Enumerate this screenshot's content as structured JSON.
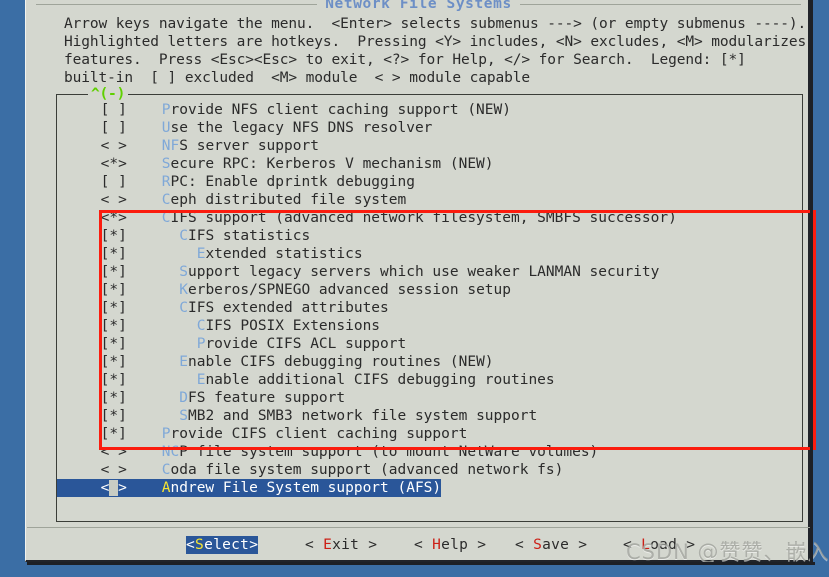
{
  "window": {
    "title": "Network File Systems",
    "background_color": "#3b6ea5",
    "dialog_color": "#d4d7cf"
  },
  "help": {
    "line1": "Arrow keys navigate the menu.  <Enter> selects submenus ---> (or empty submenus ----).",
    "line2": "Highlighted letters are hotkeys.  Pressing <Y> includes, <N> excludes, <M> modularizes",
    "line3": "features.  Press <Esc><Esc> to exit, <?> for Help, </> for Search.  Legend: [*]",
    "line4": "built-in  [ ] excluded  <M> module  < > module capable"
  },
  "scroll_indicator": "^(-)",
  "menu": {
    "items": [
      {
        "tag": "[ ]",
        "indent": 1,
        "hotkey": "P",
        "rest": "rovide NFS client caching support (NEW)",
        "selected": false
      },
      {
        "tag": "[ ]",
        "indent": 1,
        "hotkey": "U",
        "rest": "se the legacy NFS DNS resolver",
        "selected": false
      },
      {
        "tag": "< >",
        "indent": 1,
        "hotkey": "NF",
        "rest": "S server support",
        "selected": false
      },
      {
        "tag": "<*>",
        "indent": 1,
        "hotkey": "S",
        "rest": "ecure RPC: Kerberos V mechanism (NEW)",
        "selected": false
      },
      {
        "tag": "[ ]",
        "indent": 1,
        "hotkey": "R",
        "rest": "PC: Enable dprintk debugging",
        "selected": false
      },
      {
        "tag": "< >",
        "indent": 1,
        "hotkey": "C",
        "rest": "eph distributed file system",
        "selected": false
      },
      {
        "tag": "<*>",
        "indent": 1,
        "hotkey": "C",
        "rest": "IFS support (advanced network filesystem, SMBFS successor)",
        "selected": false
      },
      {
        "tag": "[*]",
        "indent": 2,
        "hotkey": "C",
        "rest": "IFS statistics",
        "selected": false
      },
      {
        "tag": "[*]",
        "indent": 3,
        "hotkey": "E",
        "rest": "xtended statistics",
        "selected": false
      },
      {
        "tag": "[*]",
        "indent": 2,
        "hotkey": "S",
        "rest": "upport legacy servers which use weaker LANMAN security",
        "selected": false
      },
      {
        "tag": "[*]",
        "indent": 2,
        "hotkey": "K",
        "rest": "erberos/SPNEGO advanced session setup",
        "selected": false
      },
      {
        "tag": "[*]",
        "indent": 2,
        "hotkey": "C",
        "rest": "IFS extended attributes",
        "selected": false
      },
      {
        "tag": "[*]",
        "indent": 3,
        "hotkey": "C",
        "rest": "IFS POSIX Extensions",
        "selected": false
      },
      {
        "tag": "[*]",
        "indent": 3,
        "hotkey": "P",
        "rest": "rovide CIFS ACL support",
        "selected": false
      },
      {
        "tag": "[*]",
        "indent": 2,
        "hotkey": "E",
        "rest": "nable CIFS debugging routines (NEW)",
        "selected": false
      },
      {
        "tag": "[*]",
        "indent": 3,
        "hotkey": "E",
        "rest": "nable additional CIFS debugging routines",
        "selected": false
      },
      {
        "tag": "[*]",
        "indent": 2,
        "hotkey": "D",
        "rest": "FS feature support",
        "selected": false
      },
      {
        "tag": "[*]",
        "indent": 2,
        "hotkey": "S",
        "rest": "MB2 and SMB3 network file system support",
        "selected": false
      },
      {
        "tag": "[*]",
        "indent": 1,
        "hotkey": "P",
        "rest": "rovide CIFS client caching support",
        "selected": false
      },
      {
        "tag": "< >",
        "indent": 1,
        "hotkey": "NC",
        "rest": "P file system support (to mount NetWare volumes)",
        "selected": false
      },
      {
        "tag": "< >",
        "indent": 1,
        "hotkey": "C",
        "rest": "oda file system support (advanced network fs)",
        "selected": false
      },
      {
        "tag": "< >",
        "indent": 1,
        "hotkey": "A",
        "rest": "ndrew File System support (AFS)",
        "selected": true
      }
    ]
  },
  "buttons": [
    {
      "left": "<",
      "hotkey": "S",
      "rest": "elect",
      "right": ">",
      "active": true
    },
    {
      "left": "< ",
      "hotkey": "E",
      "rest": "xit",
      "right": " >",
      "active": false
    },
    {
      "left": "< ",
      "hotkey": "H",
      "rest": "elp",
      "right": " >",
      "active": false
    },
    {
      "left": "< ",
      "hotkey": "S",
      "rest": "ave",
      "right": " >",
      "active": false
    },
    {
      "left": "< ",
      "hotkey": "L",
      "rest": "oad",
      "right": " >",
      "active": false
    }
  ],
  "annotation": {
    "type": "red-rectangle",
    "color": "#fb1c0e"
  },
  "watermark": "CSDN @赞赞、嵌入式"
}
